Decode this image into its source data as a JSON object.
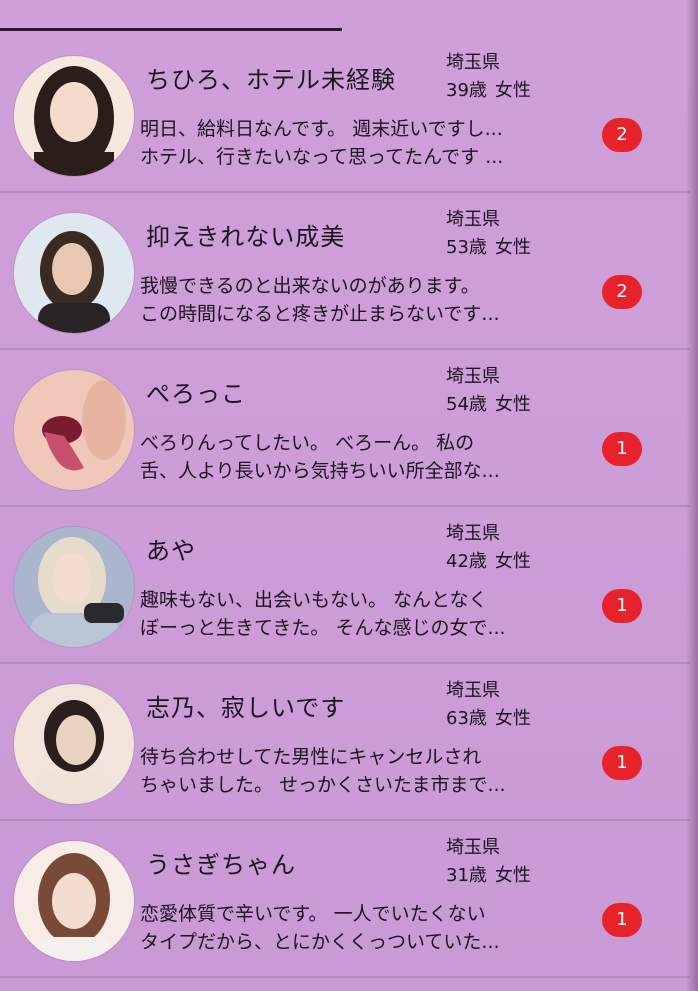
{
  "conversations": [
    {
      "name": "ちひろ、ホテル未経験",
      "prefecture": "埼玉県",
      "age": "39歳",
      "gender": "女性",
      "message_line1": "明日、給料日なんです。 週末近いですし...",
      "message_line2": "ホテル、行きたいなって思ってたんです ...",
      "unread": "2",
      "avatar_colors": [
        "#f3dccd",
        "#2b1d18",
        "#f6e8dc"
      ]
    },
    {
      "name": "抑えきれない成美",
      "prefecture": "埼玉県",
      "age": "53歳",
      "gender": "女性",
      "message_line1": "我慢できるのと出来ないのがあります。",
      "message_line2": "この時間になると疼きが止まらないです...",
      "unread": "2",
      "avatar_colors": [
        "#dfe7ef",
        "#3a2a24",
        "#e9c7b1"
      ]
    },
    {
      "name": "ぺろっこ",
      "prefecture": "埼玉県",
      "age": "54歳",
      "gender": "女性",
      "message_line1": "べろりんってしたい。 べろーん。 私の",
      "message_line2": "舌、人より長いから気持ちいい所全部な...",
      "unread": "1",
      "avatar_colors": [
        "#f0c7b8",
        "#7a1c2e",
        "#c8506e"
      ]
    },
    {
      "name": "あや",
      "prefecture": "埼玉県",
      "age": "42歳",
      "gender": "女性",
      "message_line1": "趣味もない、出会いもない。 なんとなく",
      "message_line2": "ぼーっと生きてきた。 そんな感じの女で...",
      "unread": "1",
      "avatar_colors": [
        "#b9c4d4",
        "#e7dccb",
        "#a9b6cc"
      ]
    },
    {
      "name": "志乃、寂しいです",
      "prefecture": "埼玉県",
      "age": "63歳",
      "gender": "女性",
      "message_line1": "待ち合わせしてた男性にキャンセルされ",
      "message_line2": "ちゃいました。 せっかくさいたま市まで...",
      "unread": "1",
      "avatar_colors": [
        "#e8d3c3",
        "#2a1f1c",
        "#f2e4da"
      ]
    },
    {
      "name": "うさぎちゃん",
      "prefecture": "埼玉県",
      "age": "31歳",
      "gender": "女性",
      "message_line1": "恋愛体質で辛いです。 一人でいたくない",
      "message_line2": "タイプだから、とにかくくっついていた...",
      "unread": "1",
      "avatar_colors": [
        "#f2ddd0",
        "#7a4a38",
        "#f8ece6"
      ]
    }
  ],
  "theme": {
    "background": "#cfa0d8",
    "divider": "#b68bbf",
    "badge": "#e8222b",
    "text": "#1c1420"
  }
}
